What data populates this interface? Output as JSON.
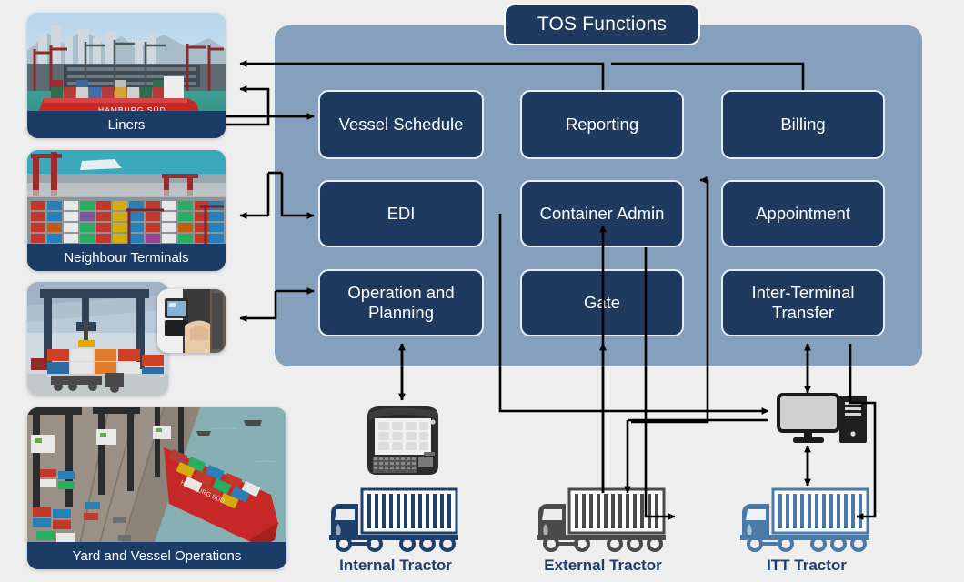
{
  "diagram": {
    "title": "TOS Functions",
    "panel_color": "#84a0bd",
    "box_color": "#1e3a5f",
    "accent_label_color": "#1f3f6b",
    "background_color": "#eeeeee"
  },
  "functions": [
    {
      "label": "Vessel Schedule",
      "name": "vessel-schedule"
    },
    {
      "label": "Reporting",
      "name": "reporting"
    },
    {
      "label": "Billing",
      "name": "billing"
    },
    {
      "label": "EDI",
      "name": "edi"
    },
    {
      "label": "Container Admin",
      "name": "container-admin"
    },
    {
      "label": "Appointment",
      "name": "appointment"
    },
    {
      "label": "Operation and Planning",
      "name": "operation-and-planning"
    },
    {
      "label": "Gate",
      "name": "gate"
    },
    {
      "label": "Inter-Terminal Transfer",
      "name": "inter-terminal-transfer"
    }
  ],
  "actors": [
    {
      "label": "Liners",
      "name": "liners",
      "icon": "container-ship-photo"
    },
    {
      "label": "Neighbour Terminals",
      "name": "neighbour-terminals",
      "icon": "container-yard-photo"
    },
    {
      "label": "Yard and Vessel Operations",
      "name": "yard-and-vessel-operations",
      "icon": "quay-crane-vessel-photo"
    }
  ],
  "operations_images": {
    "main": "rtg-crane-container-stack-photo",
    "inset": "handheld-terminal-operator-photo"
  },
  "tractors": [
    {
      "label": "Internal Tractor",
      "name": "internal-tractor",
      "icon": "truck-icon",
      "color": "#1f3f6b"
    },
    {
      "label": "External Tractor",
      "name": "external-tractor",
      "icon": "truck-icon",
      "color": "#4a4a4a"
    },
    {
      "label": "ITT Tractor",
      "name": "itt-tractor",
      "icon": "truck-icon",
      "color": "#4a7aa8"
    }
  ],
  "devices": [
    {
      "name": "handheld-terminal-icon",
      "label": "handheld terminal"
    },
    {
      "name": "desktop-monitor-icon",
      "label": "desktop monitor"
    },
    {
      "name": "pc-tower-icon",
      "label": "pc tower"
    }
  ]
}
